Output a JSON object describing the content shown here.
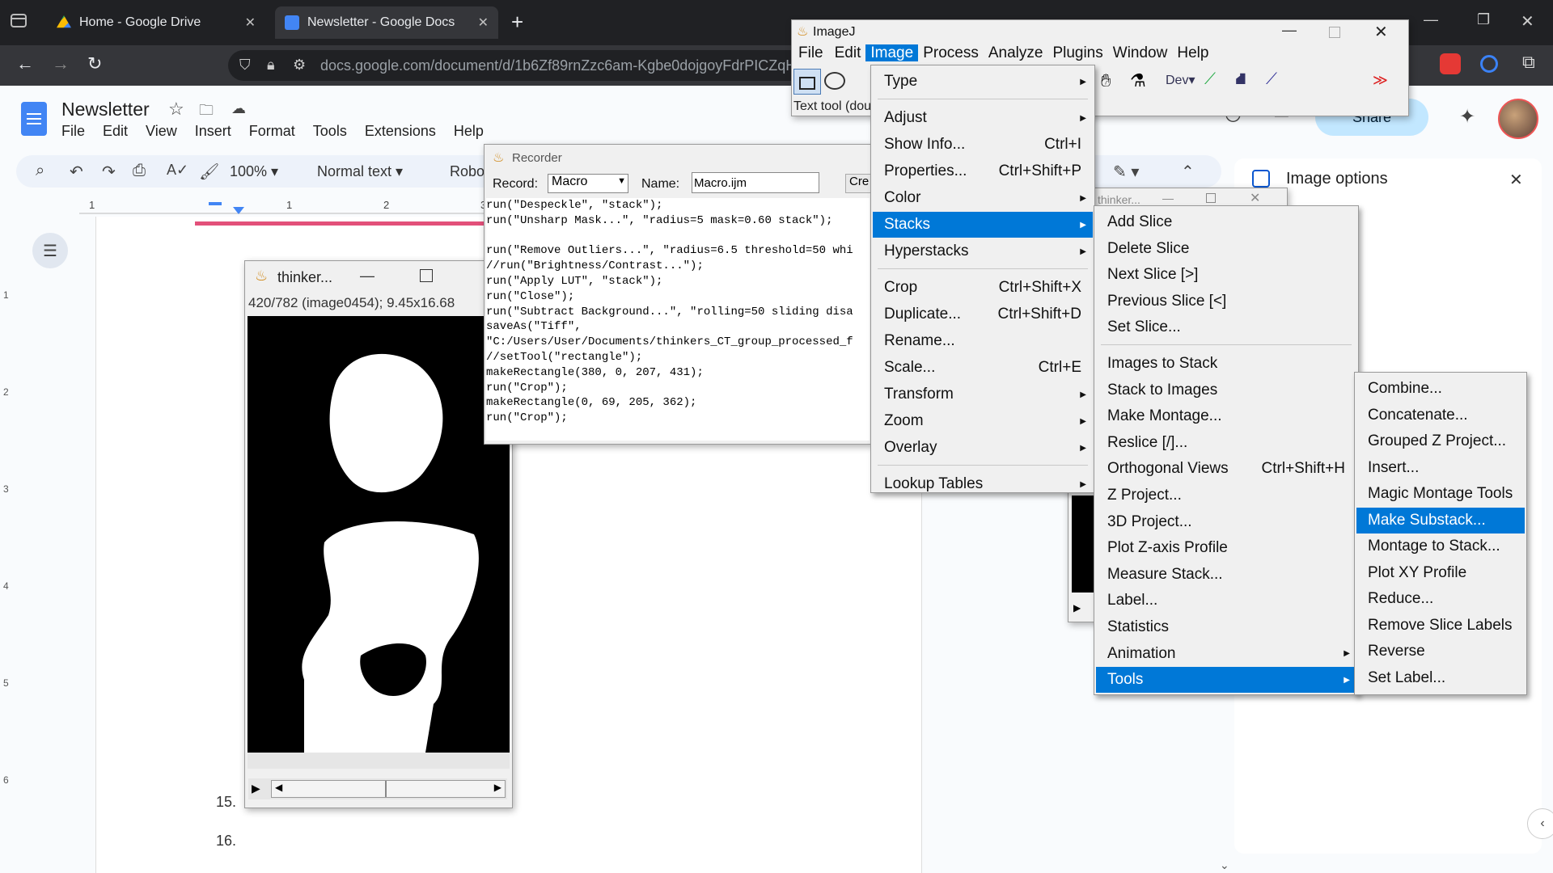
{
  "browser": {
    "tabs": [
      {
        "label": "Home - Google Drive",
        "active": false
      },
      {
        "label": "Newsletter - Google Docs",
        "active": true
      }
    ],
    "new_tab": "+",
    "url": "docs.google.com/document/d/1b6Zf89rnZzc6am-Kgbe0dojgoyFdrPICZqHlJt"
  },
  "docs": {
    "title": "Newsletter",
    "menu": [
      "File",
      "Edit",
      "View",
      "Insert",
      "Format",
      "Tools",
      "Extensions",
      "Help"
    ],
    "zoom": "100%",
    "style": "Normal text",
    "font": "Robo",
    "share_label": "Share",
    "side_panel_title": "Image options",
    "list_numbers": [
      "15.",
      "16."
    ],
    "ruler_marks": [
      "1",
      "1",
      "2",
      "3"
    ],
    "left_ruler_marks": [
      "1",
      "2",
      "3",
      "4",
      "5",
      "6"
    ]
  },
  "imagej": {
    "title": "ImageJ",
    "menubar": [
      "File",
      "Edit",
      "Image",
      "Process",
      "Analyze",
      "Plugins",
      "Window",
      "Help"
    ],
    "status": "Text tool (dou",
    "dev_label": "Dev"
  },
  "recorder": {
    "title": "Recorder",
    "record_label": "Record:",
    "record_value": "Macro",
    "name_label": "Name:",
    "name_value": "Macro.ijm",
    "create_label": "Cre",
    "lines": [
      "run(\"Despeckle\", \"stack\");",
      "run(\"Unsharp Mask...\", \"radius=5 mask=0.60 stack\");",
      "",
      "run(\"Remove Outliers...\", \"radius=6.5 threshold=50 whi",
      "//run(\"Brightness/Contrast...\");",
      "run(\"Apply LUT\", \"stack\");",
      "run(\"Close\");",
      "run(\"Subtract Background...\", \"rolling=50 sliding disa",
      "saveAs(\"Tiff\",",
      "\"C:/Users/User/Documents/thinkers_CT_group_processed_f",
      "//setTool(\"rectangle\");",
      "makeRectangle(380, 0, 207, 431);",
      "run(\"Crop\");",
      "makeRectangle(0, 69, 205, 362);",
      "run(\"Crop\");"
    ]
  },
  "image_window": {
    "title": "thinker...",
    "info": "420/782 (image0454); 9.45x16.68"
  },
  "thinker_small": {
    "title": "thinker..."
  },
  "image_menu": [
    {
      "label": "Type",
      "shortcut": "",
      "submenu": true
    },
    {
      "label": "Adjust",
      "shortcut": "",
      "submenu": true
    },
    {
      "label": "Show Info...",
      "shortcut": "Ctrl+I",
      "submenu": false
    },
    {
      "label": "Properties...",
      "shortcut": "Ctrl+Shift+P",
      "submenu": false
    },
    {
      "label": "Color",
      "shortcut": "",
      "submenu": true
    },
    {
      "label": "Stacks",
      "shortcut": "",
      "submenu": true
    },
    {
      "label": "Hyperstacks",
      "shortcut": "",
      "submenu": true
    },
    {
      "label": "Crop",
      "shortcut": "Ctrl+Shift+X",
      "submenu": false
    },
    {
      "label": "Duplicate...",
      "shortcut": "Ctrl+Shift+D",
      "submenu": false
    },
    {
      "label": "Rename...",
      "shortcut": "",
      "submenu": false
    },
    {
      "label": "Scale...",
      "shortcut": "Ctrl+E",
      "submenu": false
    },
    {
      "label": "Transform",
      "shortcut": "",
      "submenu": true
    },
    {
      "label": "Zoom",
      "shortcut": "",
      "submenu": true
    },
    {
      "label": "Overlay",
      "shortcut": "",
      "submenu": true
    },
    {
      "label": "Lookup Tables",
      "shortcut": "",
      "submenu": true
    }
  ],
  "stacks_menu": [
    {
      "label": "Add Slice",
      "shortcut": ""
    },
    {
      "label": "Delete Slice",
      "shortcut": ""
    },
    {
      "label": "Next Slice [>]",
      "shortcut": ""
    },
    {
      "label": "Previous Slice [<]",
      "shortcut": ""
    },
    {
      "label": "Set Slice...",
      "shortcut": ""
    },
    {
      "label": "Images to Stack",
      "shortcut": ""
    },
    {
      "label": "Stack to Images",
      "shortcut": ""
    },
    {
      "label": "Make Montage...",
      "shortcut": ""
    },
    {
      "label": "Reslice [/]...",
      "shortcut": ""
    },
    {
      "label": "Orthogonal Views",
      "shortcut": "Ctrl+Shift+H"
    },
    {
      "label": "Z Project...",
      "shortcut": ""
    },
    {
      "label": "3D Project...",
      "shortcut": ""
    },
    {
      "label": "Plot Z-axis Profile",
      "shortcut": ""
    },
    {
      "label": "Measure Stack...",
      "shortcut": ""
    },
    {
      "label": "Label...",
      "shortcut": ""
    },
    {
      "label": "Statistics",
      "shortcut": ""
    },
    {
      "label": "Animation",
      "shortcut": ""
    },
    {
      "label": "Tools",
      "shortcut": ""
    }
  ],
  "tools_menu": [
    "Combine...",
    "Concatenate...",
    "Grouped Z Project...",
    "Insert...",
    "Magic Montage Tools",
    "Make Substack...",
    "Montage to Stack...",
    "Plot XY Profile",
    "Reduce...",
    "Remove Slice Labels",
    "Reverse",
    "Set Label..."
  ],
  "colors": {
    "selection": "#0078d7",
    "accent": "#0b57d0",
    "docs_blue": "#4285f4"
  }
}
